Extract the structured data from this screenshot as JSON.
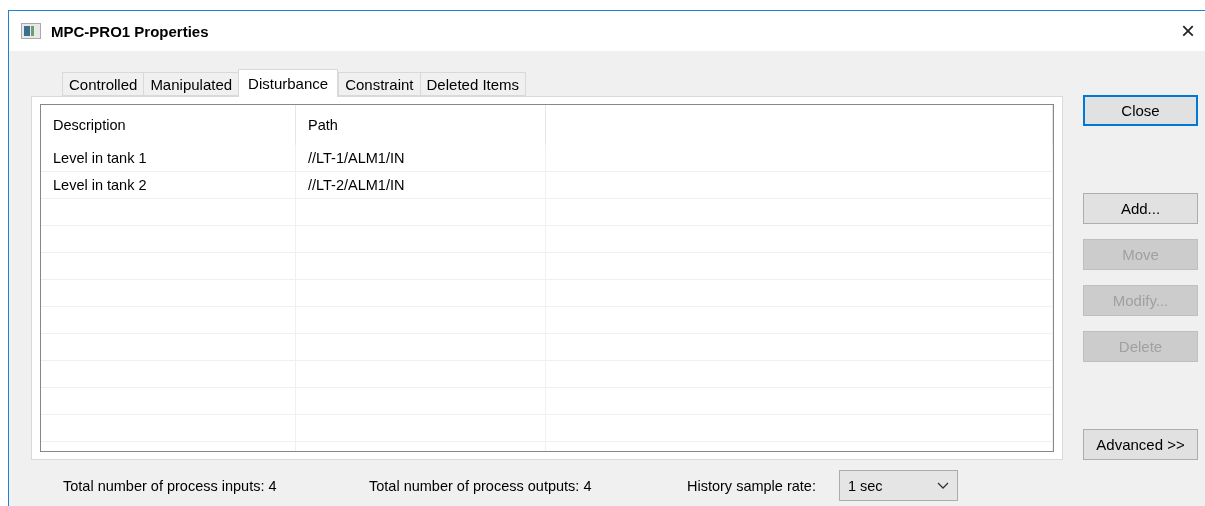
{
  "window": {
    "title": "MPC-PRO1 Properties",
    "close": "×"
  },
  "tabs": [
    {
      "label": "Controlled",
      "selected": false
    },
    {
      "label": "Manipulated",
      "selected": false
    },
    {
      "label": "Disturbance",
      "selected": true
    },
    {
      "label": "Constraint",
      "selected": false
    },
    {
      "label": "Deleted Items",
      "selected": false
    }
  ],
  "table": {
    "columns": [
      "Description",
      "Path"
    ],
    "rows": [
      [
        "Level in tank 1",
        "//LT-1/ALM1/IN"
      ],
      [
        "Level in tank 2",
        "//LT-2/ALM1/IN"
      ]
    ]
  },
  "buttons": [
    {
      "label": "Close",
      "disabled": false,
      "default": true
    },
    {
      "label": "Add...",
      "disabled": false,
      "default": false
    },
    {
      "label": "Move",
      "disabled": true,
      "default": false
    },
    {
      "label": "Modify...",
      "disabled": true,
      "default": false
    },
    {
      "label": "Delete",
      "disabled": true,
      "default": false
    },
    {
      "label": "Advanced >>",
      "disabled": false,
      "default": false
    }
  ],
  "status": {
    "inputs": "Total number of process inputs: 4",
    "outputs": "Total number of process outputs: 4",
    "rate_label": "History sample rate:",
    "rate_value": "1 sec"
  }
}
